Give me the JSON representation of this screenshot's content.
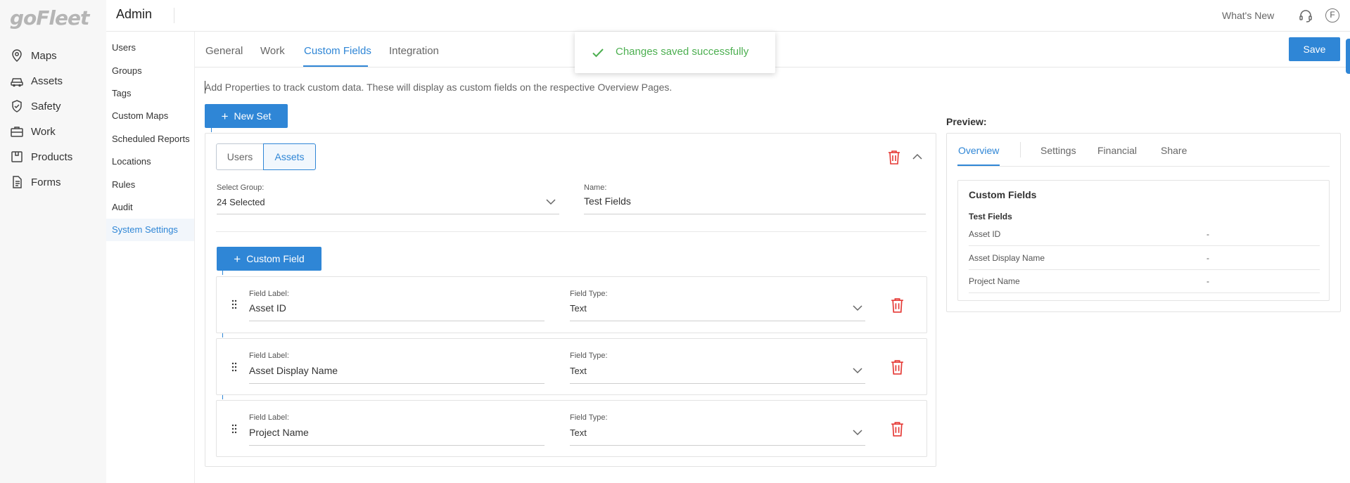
{
  "app": {
    "logo": "goFleet"
  },
  "nav": {
    "items": [
      {
        "label": "Maps",
        "icon": "map-pin-icon"
      },
      {
        "label": "Assets",
        "icon": "car-icon"
      },
      {
        "label": "Safety",
        "icon": "shield-check-icon"
      },
      {
        "label": "Work",
        "icon": "briefcase-icon"
      },
      {
        "label": "Products",
        "icon": "box-icon"
      },
      {
        "label": "Forms",
        "icon": "document-icon"
      }
    ]
  },
  "header": {
    "title": "Admin",
    "whats_new": "What's New",
    "avatar_initial": "F"
  },
  "submenu": {
    "items": [
      "Users",
      "Groups",
      "Tags",
      "Custom Maps",
      "Scheduled Reports",
      "Locations",
      "Rules",
      "Audit",
      "System Settings"
    ],
    "active": "System Settings"
  },
  "tabs": {
    "items": [
      "General",
      "Work",
      "Custom Fields",
      "Integration"
    ],
    "active": "Custom Fields"
  },
  "save_label": "Save",
  "toast": {
    "message": "Changes saved successfully"
  },
  "description": "Add Properties to track custom data. These will display as custom fields on the respective Overview Pages.",
  "new_set_label": "New Set",
  "set": {
    "toggle": [
      "Users",
      "Assets"
    ],
    "toggle_active": "Assets",
    "select_group_label": "Select Group:",
    "select_group_value": "24 Selected",
    "name_label": "Name:",
    "name_value": "Test Fields",
    "custom_field_button": "Custom Field",
    "fields": [
      {
        "label_caption": "Field Label:",
        "label": "Asset ID",
        "type_caption": "Field Type:",
        "type": "Text"
      },
      {
        "label_caption": "Field Label:",
        "label": "Asset Display Name",
        "type_caption": "Field Type:",
        "type": "Text"
      },
      {
        "label_caption": "Field Label:",
        "label": "Project Name",
        "type_caption": "Field Type:",
        "type": "Text"
      }
    ]
  },
  "preview": {
    "label": "Preview:",
    "tabs": [
      "Overview",
      "Settings",
      "Financial",
      "Share"
    ],
    "active_tab": "Overview",
    "card_title": "Custom Fields",
    "set_name": "Test Fields",
    "rows": [
      {
        "label": "Asset ID",
        "value": "-"
      },
      {
        "label": "Asset Display Name",
        "value": "-"
      },
      {
        "label": "Project Name",
        "value": "-"
      }
    ]
  },
  "colors": {
    "accent": "#2f86d6",
    "success": "#4caf50",
    "danger": "#e53935"
  }
}
